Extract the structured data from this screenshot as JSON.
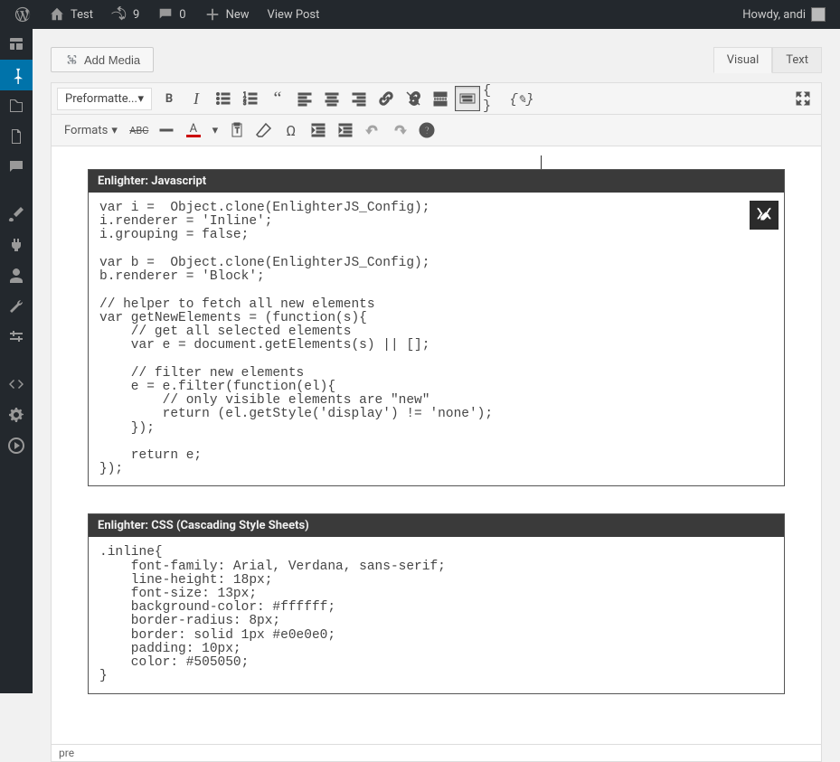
{
  "adminbar": {
    "site_name": "Test",
    "updates_count": "9",
    "comments_count": "0",
    "new_label": "New",
    "view_label": "View Post",
    "greeting": "Howdy, andi"
  },
  "buttons": {
    "add_media": "Add Media"
  },
  "tabs": {
    "visual": "Visual",
    "text": "Text"
  },
  "toolbar": {
    "format_select": "Preformatte...",
    "formats_label": "Formats"
  },
  "code_blocks": [
    {
      "title": "Enlighter: Javascript",
      "code": "var i =  Object.clone(EnlighterJS_Config);\ni.renderer = 'Inline';\ni.grouping = false;\n\nvar b =  Object.clone(EnlighterJS_Config);\nb.renderer = 'Block';\n\n// helper to fetch all new elements\nvar getNewElements = (function(s){\n    // get all selected elements\n    var e = document.getElements(s) || [];\n\n    // filter new elements\n    e = e.filter(function(el){\n        // only visible elements are \"new\"\n        return (el.getStyle('display') != 'none');\n    });\n\n    return e;\n});"
    },
    {
      "title": "Enlighter: CSS (Cascading Style Sheets)",
      "code": ".inline{\n    font-family: Arial, Verdana, sans-serif;\n    line-height: 18px;\n    font-size: 13px;\n    background-color: #ffffff;\n    border-radius: 8px;\n    border: solid 1px #e0e0e0;\n    padding: 10px;\n    color: #505050;\n}"
    }
  ],
  "statusbar": {
    "path": "pre"
  }
}
